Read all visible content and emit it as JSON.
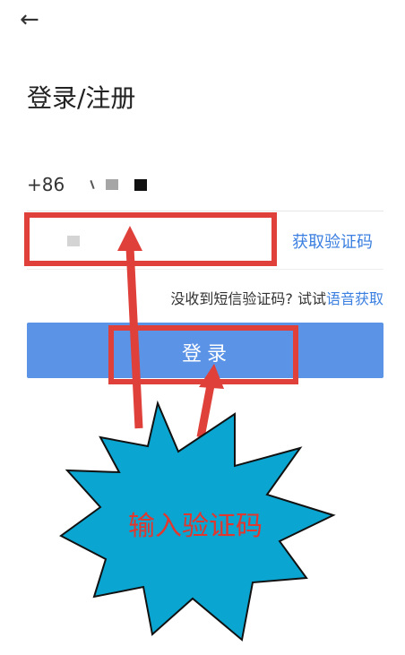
{
  "header": {
    "back_icon": "arrow-left-icon",
    "back_glyph": "←"
  },
  "page": {
    "title": "登录/注册"
  },
  "phone": {
    "country_code": "+86"
  },
  "code_field": {
    "value": "",
    "placeholder": ""
  },
  "get_code_label": "获取验证码",
  "voice": {
    "prefix": "没收到短信验证码? 试试",
    "link": "语音获取"
  },
  "login_button": {
    "label": "登录"
  },
  "annotation": {
    "callout": "输入验证码",
    "highlight_color": "#e0403a",
    "callout_fill": "#0aa6d1"
  },
  "colors": {
    "accent": "#3b7fe0",
    "button": "#5b93e6"
  }
}
